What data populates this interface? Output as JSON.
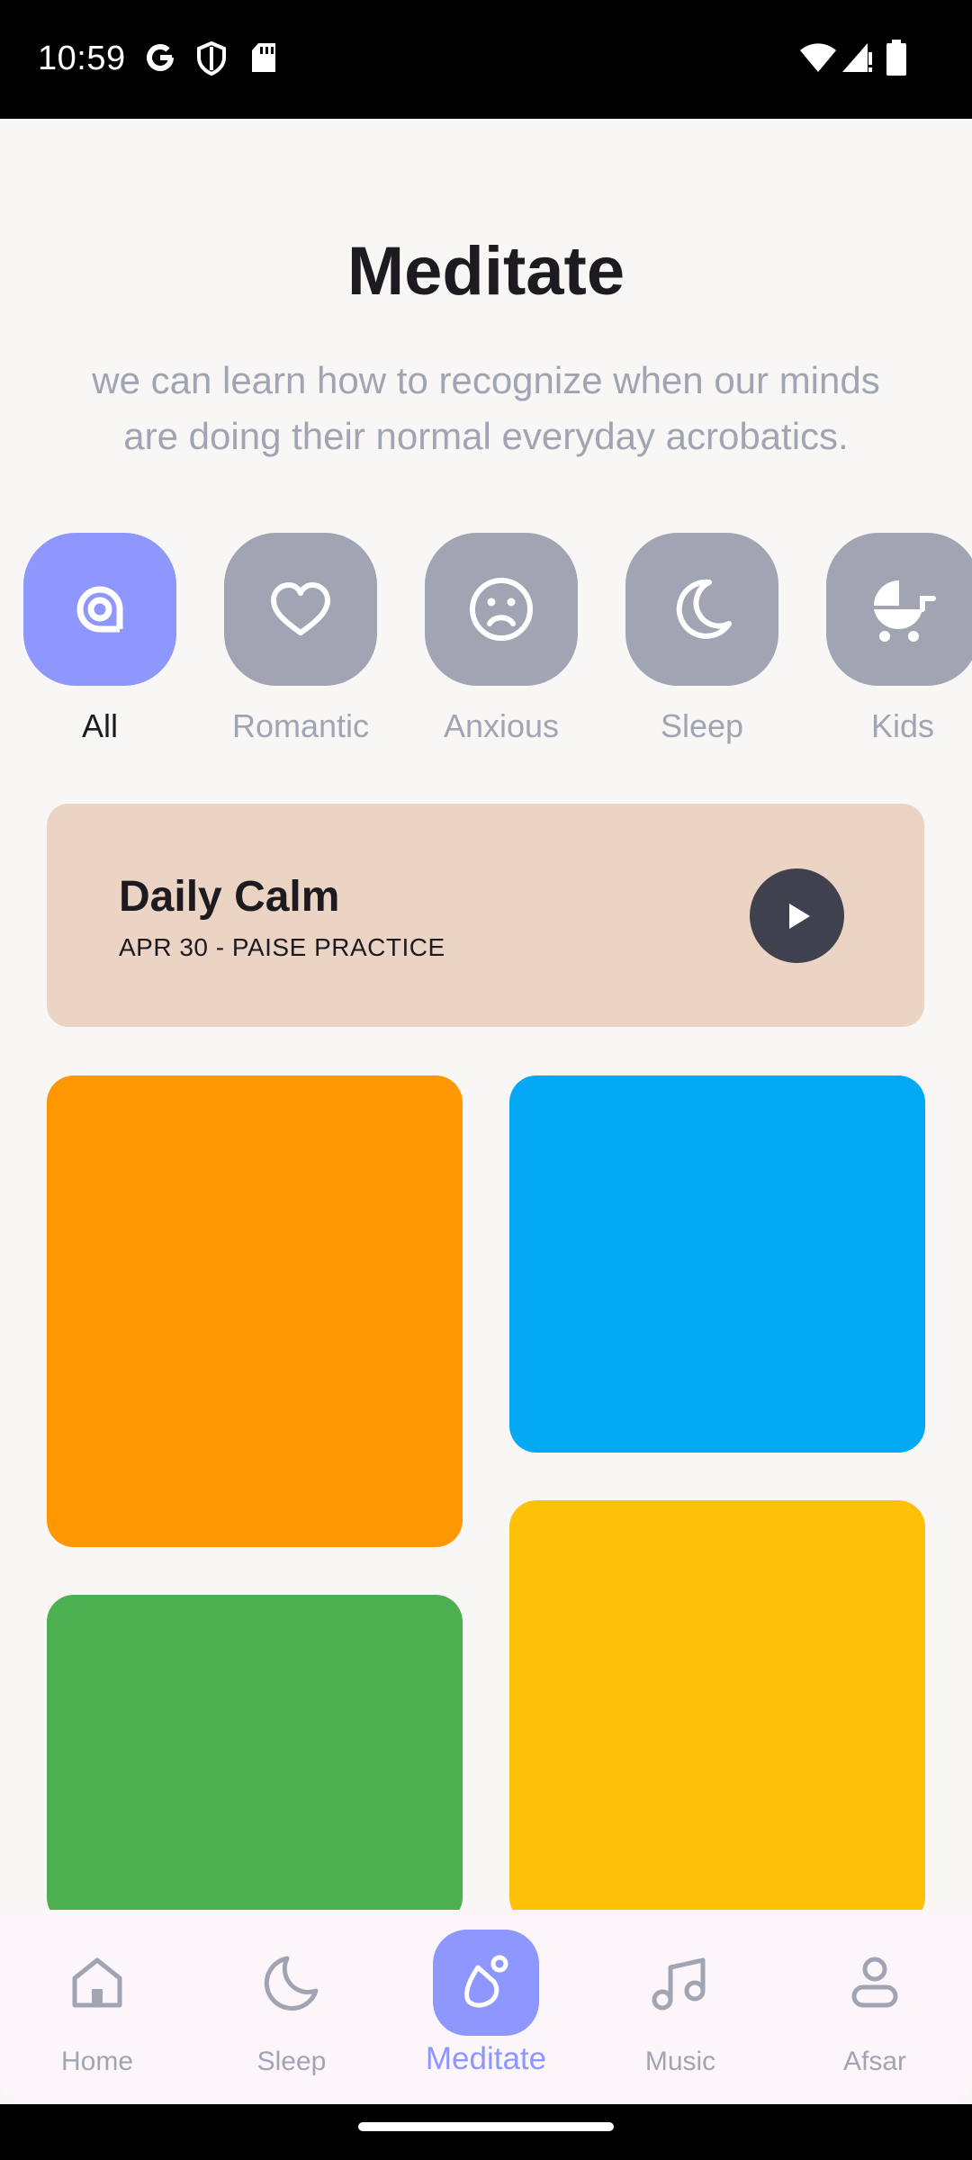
{
  "status_bar": {
    "time": "10:59",
    "left_icons": [
      "google-icon",
      "shield-icon",
      "sd-card-icon"
    ],
    "right_icons": [
      "wifi-icon",
      "signal-icon",
      "battery-icon"
    ]
  },
  "header": {
    "title": "Meditate",
    "subtitle": "we can learn how to recognize when our minds are doing their normal everyday acrobatics."
  },
  "categories": [
    {
      "label": "All",
      "icon": "at-icon",
      "active": true
    },
    {
      "label": "Romantic",
      "icon": "heart-icon",
      "active": false
    },
    {
      "label": "Anxious",
      "icon": "sad-face-icon",
      "active": false
    },
    {
      "label": "Sleep",
      "icon": "moon-icon",
      "active": false
    },
    {
      "label": "Kids",
      "icon": "stroller-icon",
      "active": false
    }
  ],
  "daily_calm": {
    "title": "Daily Calm",
    "subtitle": "APR 30 - PAISE PRACTICE",
    "play_icon": "play-icon"
  },
  "cards": [
    {
      "color": "#FF9800"
    },
    {
      "color": "#03A9F4"
    },
    {
      "color": "#FFC107"
    },
    {
      "color": "#4CAF50"
    }
  ],
  "bottom_nav": [
    {
      "label": "Home",
      "icon": "home-icon",
      "active": false
    },
    {
      "label": "Sleep",
      "icon": "moon-icon",
      "active": false
    },
    {
      "label": "Meditate",
      "icon": "meditate-icon",
      "active": true
    },
    {
      "label": "Music",
      "icon": "music-icon",
      "active": false
    },
    {
      "label": "Afsar",
      "icon": "person-icon",
      "active": false
    }
  ],
  "colors": {
    "accent": "#8E97FD",
    "inactive": "#A1A4B2",
    "daily_card": "#EBD4C4",
    "play_button": "#3F414E",
    "background": "#F8F7F5"
  }
}
